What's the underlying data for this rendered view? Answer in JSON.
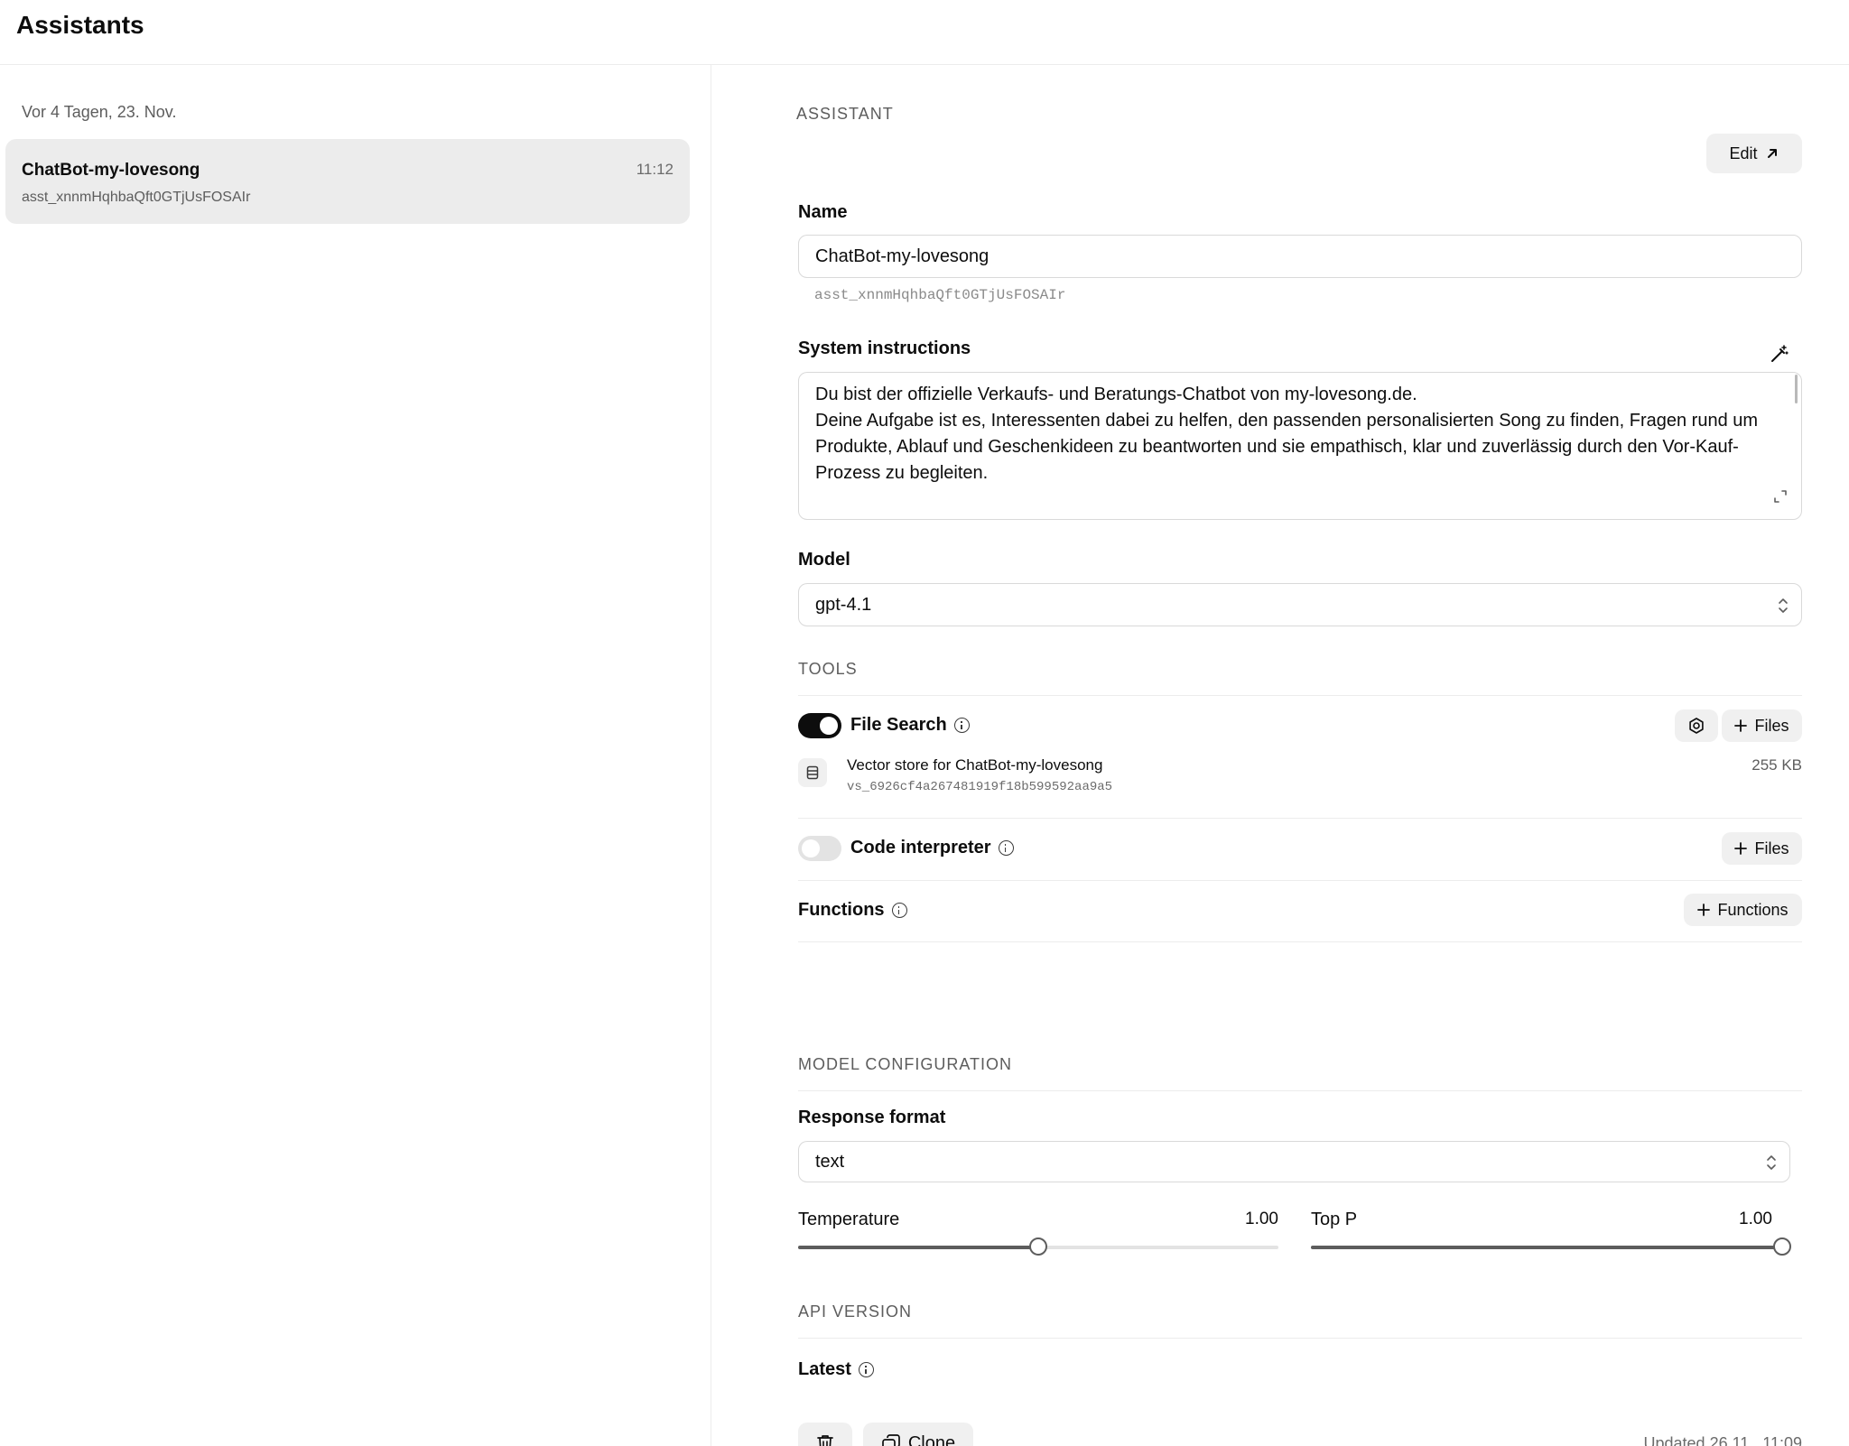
{
  "header": {
    "title": "Assistants"
  },
  "sidebar": {
    "group_label": "Vor 4 Tagen, 23. Nov.",
    "items": [
      {
        "name": "ChatBot-my-lovesong",
        "time": "11:12",
        "id": "asst_xnnmHqhbaQft0GTjUsFOSAIr"
      }
    ]
  },
  "main": {
    "section_label": "ASSISTANT",
    "edit_label": "Edit",
    "name_label": "Name",
    "name_value": "ChatBot-my-lovesong",
    "assistant_id": "asst_xnnmHqhbaQft0GTjUsFOSAIr",
    "instructions_label": "System instructions",
    "instructions_value": "Du bist der offizielle Verkaufs- und Beratungs-Chatbot von my-lovesong.de.\nDeine Aufgabe ist es, Interessenten dabei zu helfen, den passenden personalisierten Song zu finden, Fragen rund um Produkte, Ablauf und Geschenkideen zu beantworten und sie empathisch, klar und zuverlässig durch den Vor-Kauf-Prozess zu begleiten.",
    "model_label": "Model",
    "model_value": "gpt-4.1",
    "tools_label": "TOOLS",
    "file_search": {
      "label": "File Search",
      "enabled": true,
      "files_button": "Files",
      "store_name": "Vector store for ChatBot-my-lovesong",
      "store_id": "vs_6926cf4a267481919f18b599592aa9a5",
      "store_size": "255 KB"
    },
    "code_interpreter": {
      "label": "Code interpreter",
      "enabled": false,
      "files_button": "Files"
    },
    "functions": {
      "label": "Functions",
      "button": "Functions"
    },
    "model_config_label": "MODEL CONFIGURATION",
    "response_format_label": "Response format",
    "response_format_value": "text",
    "temperature": {
      "label": "Temperature",
      "value_text": "1.00",
      "fraction": 0.5
    },
    "top_p": {
      "label": "Top P",
      "value_text": "1.00",
      "fraction": 1.0
    },
    "api_version_label": "API VERSION",
    "api_version_value": "Latest",
    "clone_label": "Clone",
    "updated_text": "Updated 26.11., 11:09"
  },
  "icons": {
    "edit": "arrow-up-right-icon",
    "instructions_action": "magic-wand-icon",
    "expand": "expand-icon",
    "select": "chevron-up-down-icon",
    "settings": "gear-icon",
    "add": "plus-icon",
    "store": "database-icon",
    "info": "info-icon",
    "delete": "trash-icon",
    "clone": "copy-icon"
  }
}
